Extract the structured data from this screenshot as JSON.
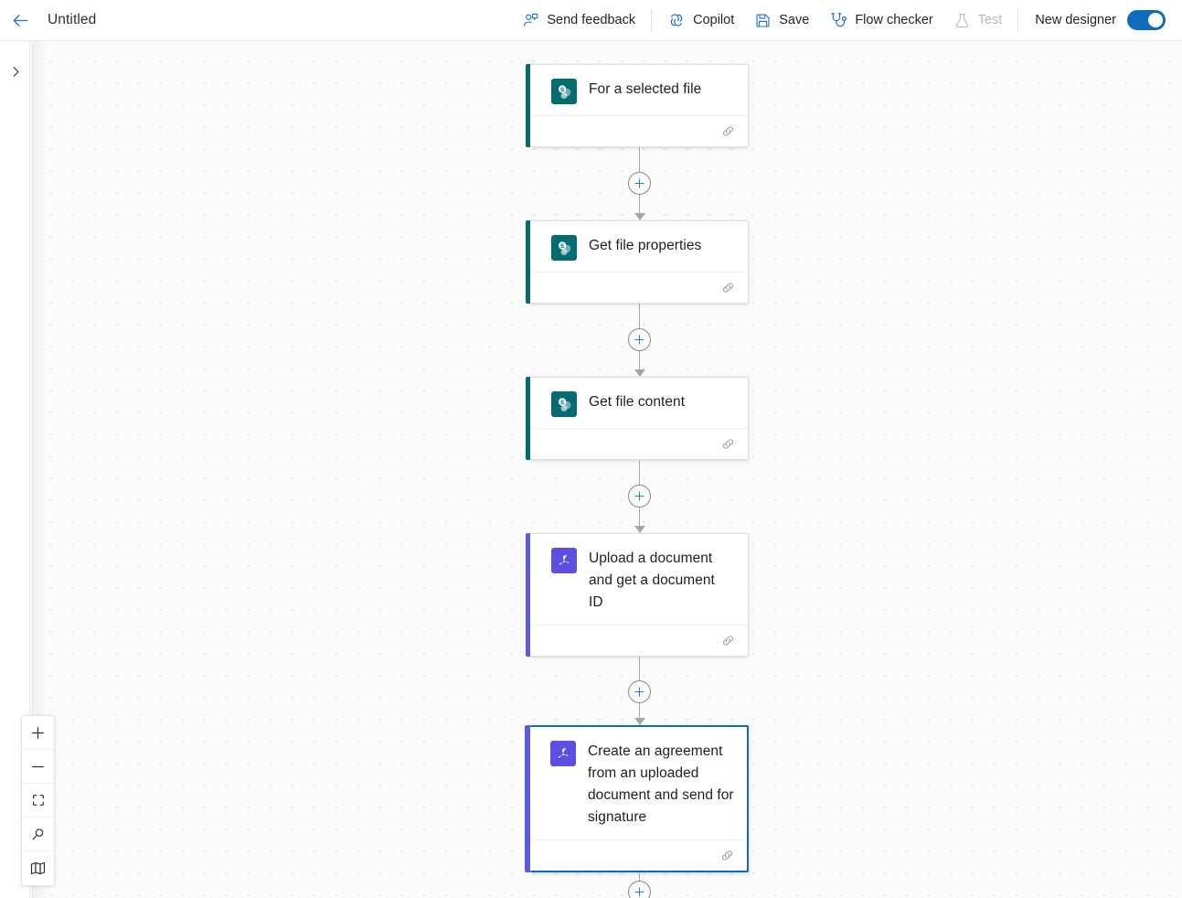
{
  "header": {
    "back_icon": "arrow-left-icon",
    "title": "Untitled",
    "commands": [
      {
        "id": "send-feedback",
        "label": "Send feedback",
        "icon": "person-feedback-icon",
        "disabled": false
      },
      {
        "id": "copilot",
        "label": "Copilot",
        "icon": "copilot-icon",
        "disabled": false
      },
      {
        "id": "save",
        "label": "Save",
        "icon": "save-disk-icon",
        "disabled": false
      },
      {
        "id": "flow-checker",
        "label": "Flow checker",
        "icon": "stethoscope-icon",
        "disabled": false
      },
      {
        "id": "test",
        "label": "Test",
        "icon": "flask-icon",
        "disabled": true
      }
    ],
    "toggle": {
      "label": "New designer",
      "on": true,
      "accent": "#0f6cbd"
    }
  },
  "left_rail": {
    "expand_icon": "chevron-right-icon"
  },
  "canvas": {
    "background": "#fbfbfb",
    "dot_color": "#dcdcdc",
    "connector_plus_label": "+"
  },
  "flow": {
    "nodes": [
      {
        "id": "for-a-selected-file",
        "title": "For a selected file",
        "icon": "sharepoint-icon",
        "accent": "#036c70",
        "icon_bg": "#036c70",
        "selected": false,
        "footer_icon": "link-icon",
        "lines": 1
      },
      {
        "id": "get-file-properties",
        "title": "Get file properties",
        "icon": "sharepoint-icon",
        "accent": "#036c70",
        "icon_bg": "#036c70",
        "selected": false,
        "footer_icon": "link-icon",
        "lines": 1
      },
      {
        "id": "get-file-content",
        "title": "Get file content",
        "icon": "sharepoint-icon",
        "accent": "#036c70",
        "icon_bg": "#036c70",
        "selected": false,
        "footer_icon": "link-icon",
        "lines": 1
      },
      {
        "id": "upload-a-document-and-get-a-document-id",
        "title": "Upload a document and get a document ID",
        "icon": "adobe-acrobat-sign-icon",
        "accent": "#5c5ce0",
        "icon_bg": "#5b4ee0",
        "selected": false,
        "footer_icon": "link-icon",
        "lines": 3
      },
      {
        "id": "create-an-agreement-from-an-uploaded-document-and-send-for-signature",
        "title": "Create an agreement from an uploaded document and send for signature",
        "icon": "adobe-acrobat-sign-icon",
        "accent": "#5c5ce0",
        "icon_bg": "#5b4ee0",
        "selected": true,
        "selection_color": "#1266c8",
        "footer_icon": "link-icon",
        "lines": 4
      }
    ]
  },
  "zoom_controls": {
    "buttons": [
      {
        "id": "zoom-in",
        "icon": "plus-icon"
      },
      {
        "id": "zoom-out",
        "icon": "minus-icon"
      },
      {
        "id": "fit-to-screen",
        "icon": "fit-to-screen-icon"
      },
      {
        "id": "search",
        "icon": "search-icon"
      },
      {
        "id": "minimap",
        "icon": "map-icon"
      }
    ]
  }
}
